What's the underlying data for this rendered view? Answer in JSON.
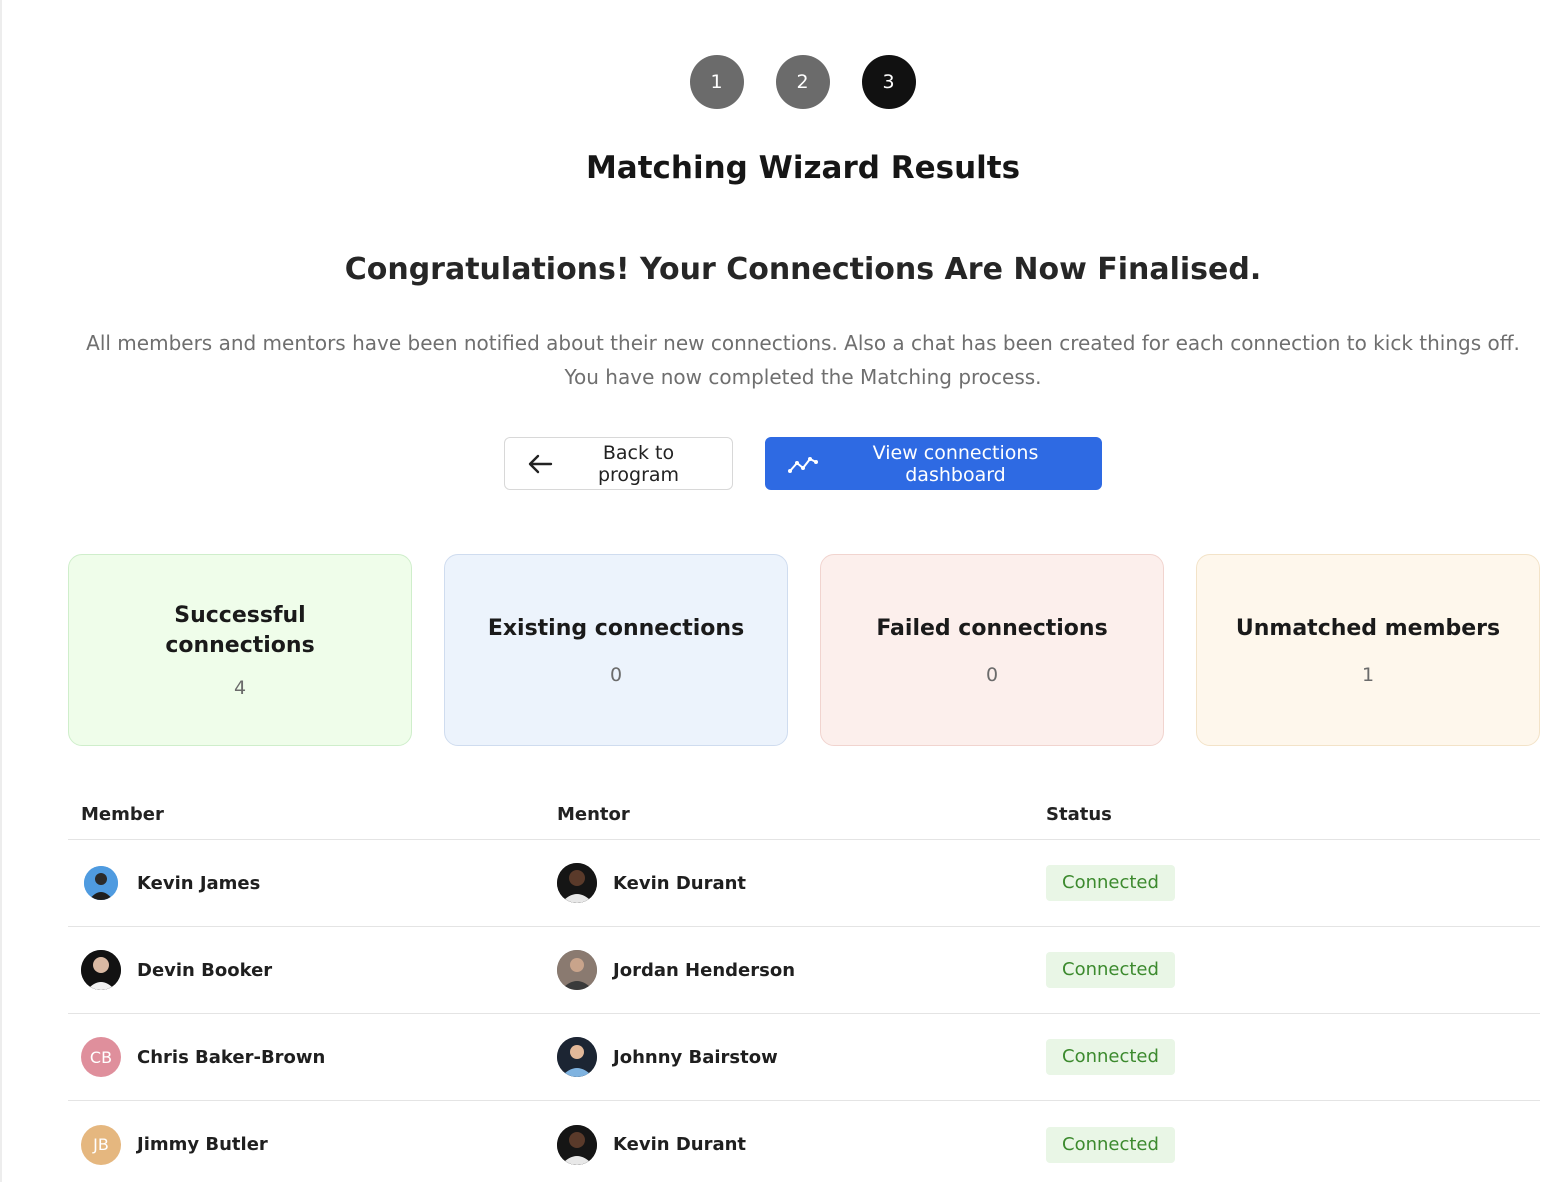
{
  "stepper": {
    "steps": [
      "1",
      "2",
      "3"
    ],
    "active_index": 2
  },
  "header": {
    "title": "Matching Wizard Results",
    "subtitle": "Congratulations! Your Connections Are Now Finalised.",
    "description": "All members and mentors have been notified about their new connections. Also a chat has been created for each connection to kick things off. You have now completed the Matching process."
  },
  "actions": {
    "back_label": "Back to program",
    "dashboard_label": "View connections dashboard"
  },
  "stats": [
    {
      "title": "Successful connections",
      "value": "4"
    },
    {
      "title": "Existing connections",
      "value": "0"
    },
    {
      "title": "Failed connections",
      "value": "0"
    },
    {
      "title": "Unmatched members",
      "value": "1"
    }
  ],
  "table": {
    "headers": {
      "member": "Member",
      "mentor": "Mentor",
      "status": "Status"
    },
    "rows": [
      {
        "member": "Kevin James",
        "member_initials": "",
        "mentor": "Kevin Durant",
        "status": "Connected"
      },
      {
        "member": "Devin Booker",
        "member_initials": "",
        "mentor": "Jordan Henderson",
        "status": "Connected"
      },
      {
        "member": "Chris Baker-Brown",
        "member_initials": "CB",
        "mentor": "Johnny Bairstow",
        "status": "Connected"
      },
      {
        "member": "Jimmy Butler",
        "member_initials": "JB",
        "mentor": "Kevin Durant",
        "status": "Connected"
      }
    ]
  },
  "colors": {
    "primary": "#2e6ae3",
    "success_badge_text": "#3c8a2e",
    "success_badge_bg": "#e9f6e6",
    "avatar_cb": "#df8f9c",
    "avatar_jb": "#e5b77f"
  }
}
